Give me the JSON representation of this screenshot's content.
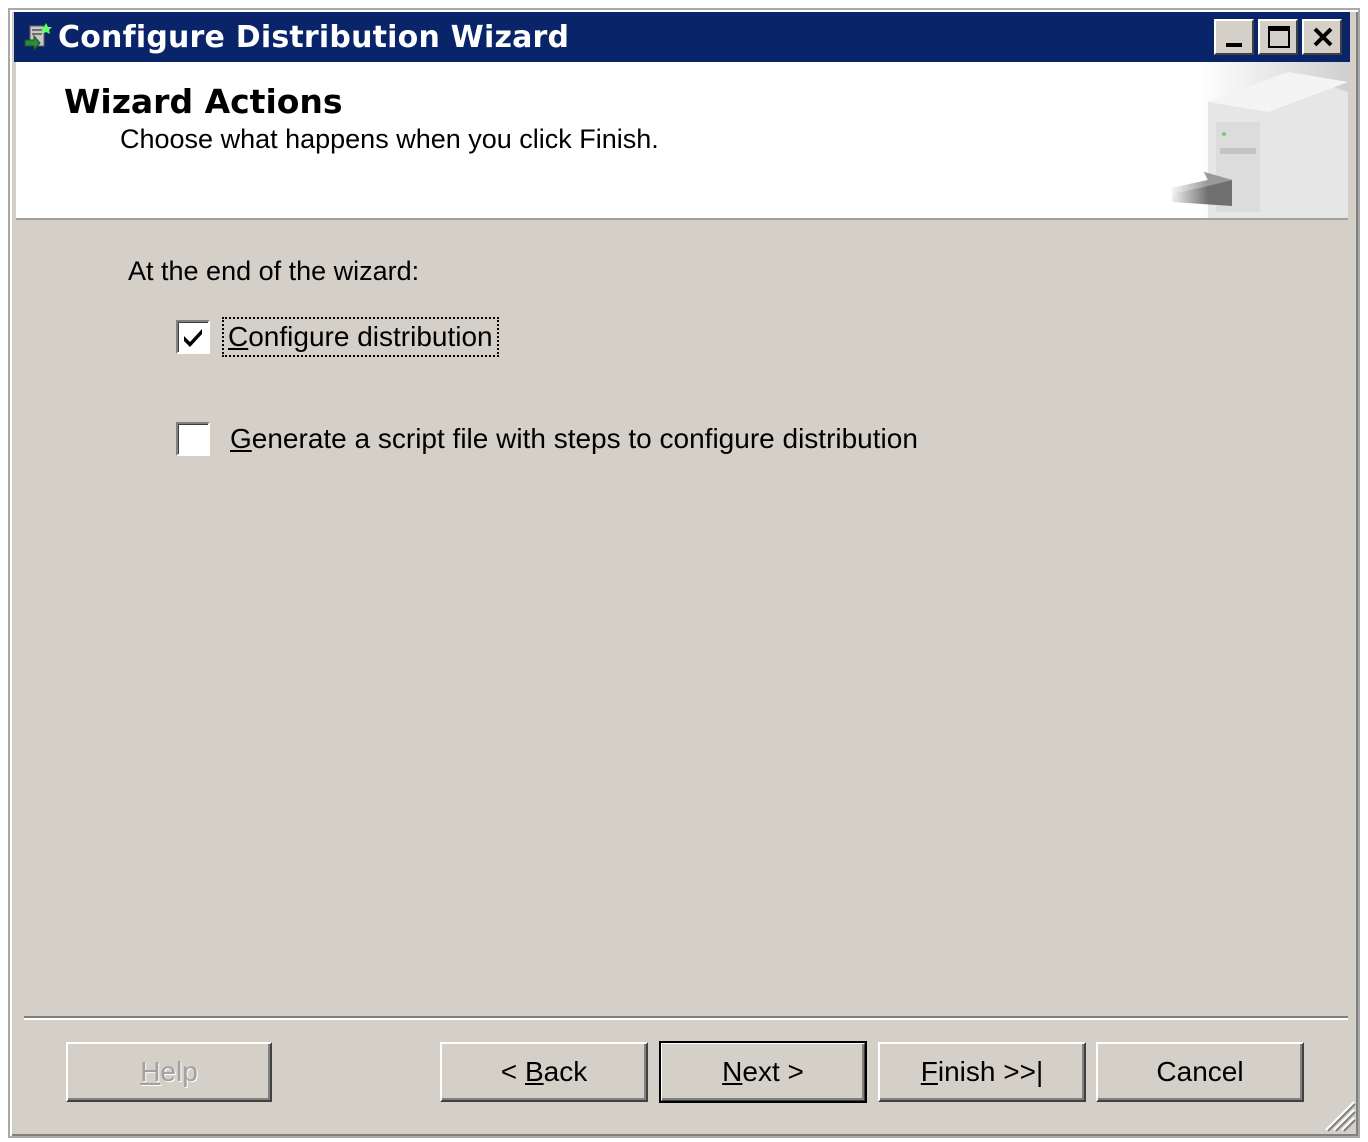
{
  "window": {
    "title": "Configure Distribution Wizard",
    "controls": {
      "minimize": "minimize",
      "maximize": "maximize",
      "close": "close"
    }
  },
  "header": {
    "title": "Wizard Actions",
    "subtitle": "Choose what happens when you click Finish."
  },
  "body": {
    "prompt": "At the end of the wizard:",
    "options": [
      {
        "label_first": "C",
        "label_rest": "onfigure distribution",
        "checked": true
      },
      {
        "label_first": "G",
        "label_rest": "enerate a script file with steps to configure distribution",
        "checked": false
      }
    ]
  },
  "buttons": {
    "help": {
      "first": "H",
      "rest": "elp",
      "enabled": false
    },
    "back": {
      "pre": "< ",
      "first": "B",
      "rest": "ack"
    },
    "next": {
      "first": "N",
      "rest": "ext >"
    },
    "finish": {
      "first": "F",
      "rest": "inish >>|"
    },
    "cancel": {
      "label": "Cancel"
    }
  },
  "colors": {
    "titlebar": "#0a246a",
    "face": "#d4d0c8",
    "header_bg": "#ffffff"
  }
}
